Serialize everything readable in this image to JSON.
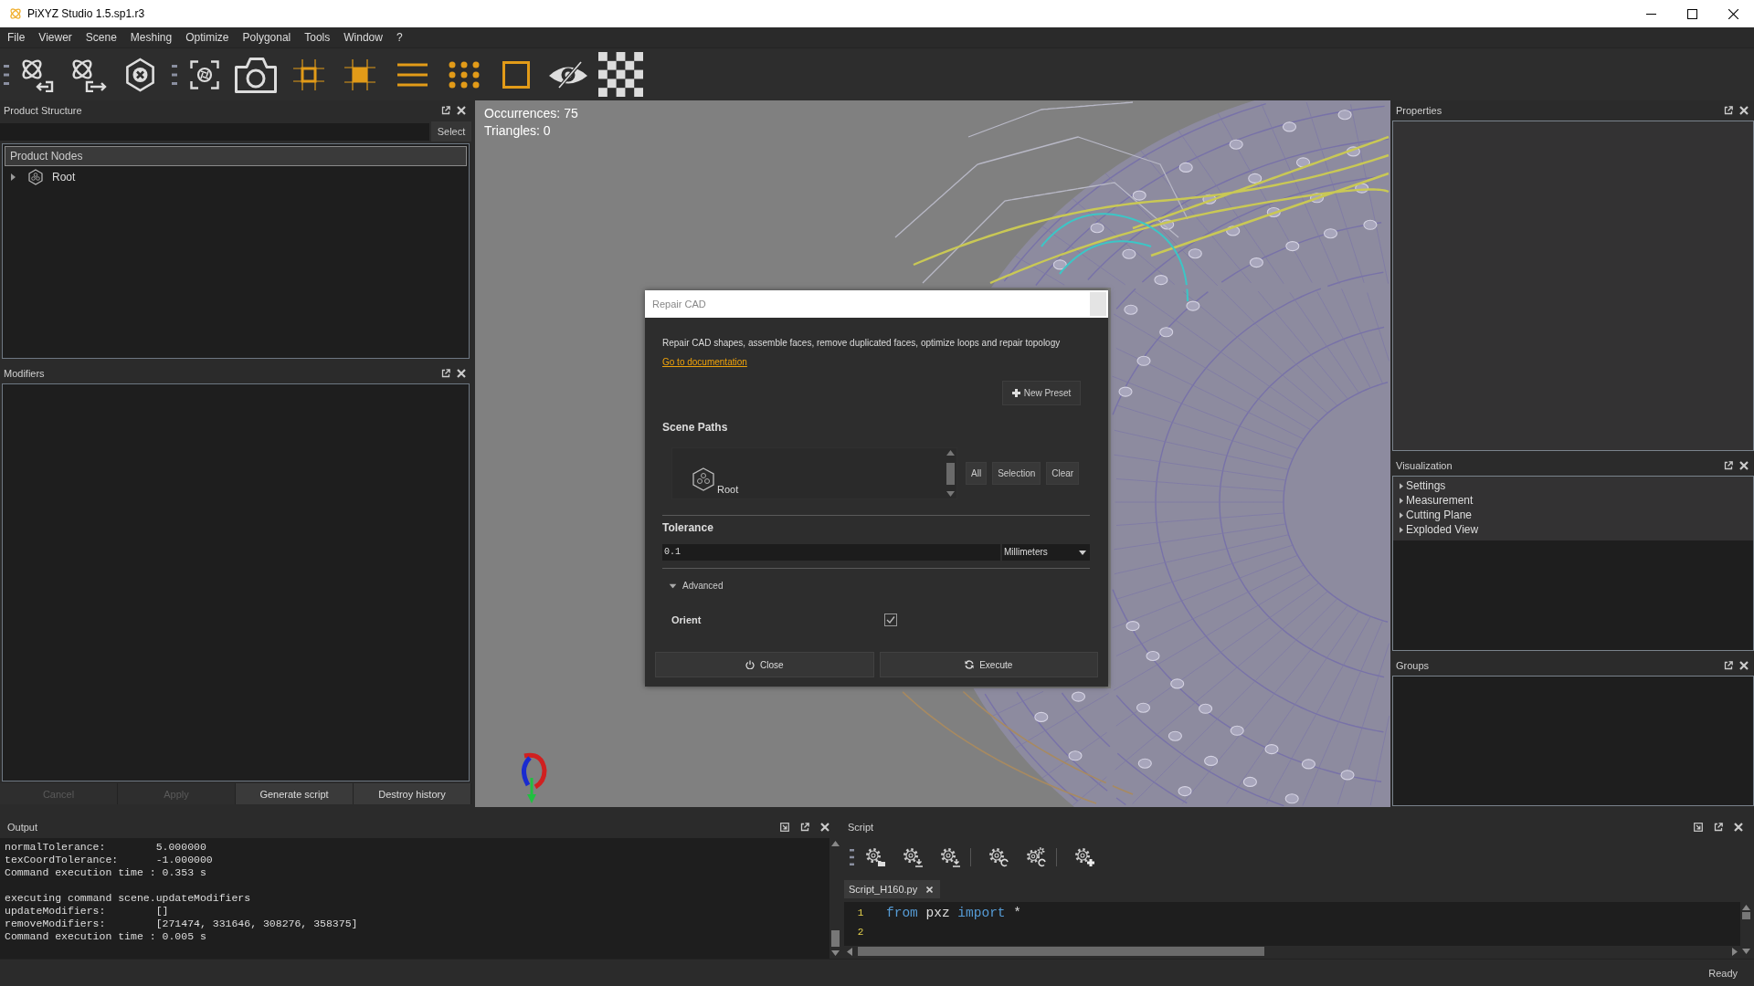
{
  "window": {
    "title": "PiXYZ Studio 1.5.sp1.r3"
  },
  "menu": [
    "File",
    "Viewer",
    "Scene",
    "Meshing",
    "Optimize",
    "Polygonal",
    "Tools",
    "Window",
    "?"
  ],
  "product_structure": {
    "title": "Product Structure",
    "select_button": "Select",
    "tree_header": "Product Nodes",
    "nodes": [
      {
        "label": "Root",
        "expanded": false
      }
    ]
  },
  "modifiers": {
    "title": "Modifiers",
    "buttons": [
      {
        "label": "Cancel",
        "disabled": true
      },
      {
        "label": "Apply",
        "disabled": true
      },
      {
        "label": "Generate script",
        "disabled": false
      },
      {
        "label": "Destroy history",
        "disabled": false
      }
    ]
  },
  "viewport": {
    "stats": [
      "Occurrences: 75",
      "Triangles: 0"
    ]
  },
  "dialog": {
    "title": "Repair CAD",
    "description": "Repair CAD shapes, assemble faces, remove duplicated faces, optimize loops and repair topology",
    "link": "Go to documentation",
    "preset_button": "New Preset",
    "scene_paths": {
      "label": "Scene Paths",
      "items": [
        "Root"
      ],
      "buttons": [
        "All",
        "Selection",
        "Clear"
      ]
    },
    "tolerance": {
      "label": "Tolerance",
      "value": "0.1",
      "unit": "Millimeters"
    },
    "advanced": {
      "label": "Advanced",
      "expanded": true
    },
    "orient": {
      "label": "Orient",
      "checked": true
    },
    "buttons": [
      {
        "kind": "close",
        "label": "Close"
      },
      {
        "kind": "execute",
        "label": "Execute"
      }
    ]
  },
  "properties": {
    "title": "Properties"
  },
  "visualization": {
    "title": "Visualization",
    "items": [
      {
        "label": "Settings",
        "expanded": false
      },
      {
        "label": "Measurement",
        "expanded": false
      },
      {
        "label": "Cutting Plane",
        "expanded": false
      },
      {
        "label": "Exploded View",
        "expanded": false
      }
    ]
  },
  "groups": {
    "title": "Groups"
  },
  "output": {
    "title": "Output",
    "blocks": [
      [
        {
          "text": "normalTolerance:",
          "value": "5.000000"
        },
        {
          "text": "texCoordTolerance:",
          "value": "-1.000000"
        },
        {
          "text": "Command execution time : 0.353 s"
        }
      ],
      [
        {
          "text": "executing command scene.updateModifiers"
        },
        {
          "text": "updateModifiers:",
          "value": "[]"
        },
        {
          "text": "removeModifiers:",
          "value": "[271474, 331646, 308276, 358375]"
        },
        {
          "text": "Command execution time : 0.005 s"
        }
      ]
    ]
  },
  "script": {
    "title": "Script",
    "tabs": [
      {
        "label": "Script_H160.py",
        "selected": true
      }
    ],
    "lines": [
      {
        "number": "1",
        "tokens": [
          {
            "kind": "keyword",
            "text": "from"
          },
          {
            "kind": "name",
            "text": "pxz"
          },
          {
            "kind": "keyword",
            "text": "import"
          },
          {
            "kind": "name",
            "text": "*"
          }
        ]
      },
      {
        "number": "2"
      }
    ]
  },
  "status_bar": {
    "text": "Ready"
  }
}
